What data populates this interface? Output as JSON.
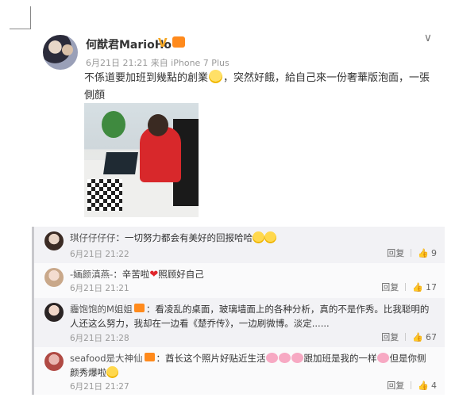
{
  "post": {
    "username": "何猷君MarioHo",
    "verified_badge": "V",
    "level_badge": "lv",
    "meta": "6月21日 21:21 来自 iPhone 7 Plus",
    "text": "不係道要加班到幾點的創業",
    "text_after_emoji": "，突然好餓，給自己來一份奢華版泡面，一張側顏",
    "chevron": "∨"
  },
  "comments": [
    {
      "user": "琪仔仔仔仔",
      "text": "：一切努力都会有美好的回报哈哈",
      "time": "6月21日 21:22",
      "reply": "回复",
      "likes": "9"
    },
    {
      "user": "-婳颜滇燕-",
      "text": "：辛苦啦",
      "text2": "照顾好自己",
      "time": "6月21日 21:21",
      "reply": "回复",
      "likes": "17"
    },
    {
      "user": "霾饱饱的M姐姐",
      "text": "：看凌乱的桌面，玻璃墙面上的各种分析，真的不是作秀。比我聪明的人还这么努力，我却在一边看《楚乔传》，一边刷微博。淡定......",
      "time": "6月21日 21:28",
      "reply": "回复",
      "likes": "67"
    },
    {
      "user": "seafood是大神仙",
      "text": "：酋长这个照片好贴近生活",
      "text2": "跟加班是我的一样",
      "text3": "但是你侧颜秀爆啦",
      "time": "6月21日 21:27",
      "reply": "回复",
      "likes": "4"
    }
  ],
  "icons": {
    "like": "thumbs-up-icon"
  },
  "colors": {
    "accent": "#ff8200",
    "badge": "#f5a623",
    "heart": "#e0262b"
  }
}
